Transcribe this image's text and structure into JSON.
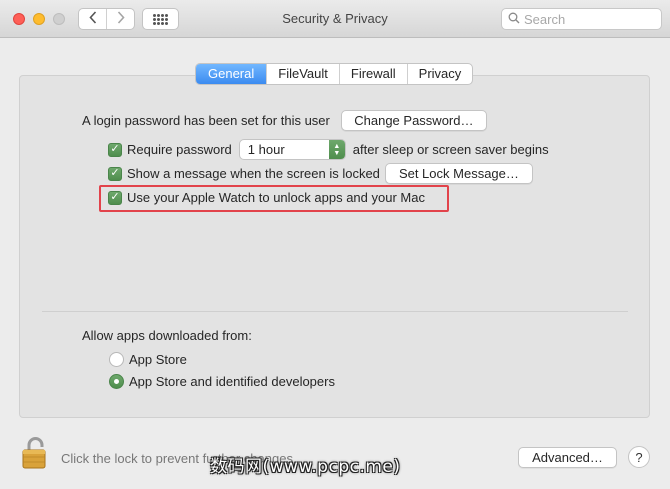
{
  "window": {
    "title": "Security & Privacy",
    "search_placeholder": "Search"
  },
  "toolbar": {
    "back_icon": "chevron-left-icon",
    "forward_icon": "chevron-right-icon",
    "show_all_icon": "grid-icon"
  },
  "tabs": [
    {
      "label": "General",
      "active": true
    },
    {
      "label": "FileVault",
      "active": false
    },
    {
      "label": "Firewall",
      "active": false
    },
    {
      "label": "Privacy",
      "active": false
    }
  ],
  "general": {
    "login_password_text": "A login password has been set for this user",
    "change_password_button": "Change Password…",
    "require_password": {
      "checked": true,
      "label": "Require password",
      "selected_value": "1 hour",
      "suffix": "after sleep or screen saver begins"
    },
    "show_message": {
      "checked": true,
      "label": "Show a message when the screen is locked",
      "button": "Set Lock Message…"
    },
    "apple_watch": {
      "checked": true,
      "label": "Use your Apple Watch to unlock apps and your Mac",
      "highlight_color": "#e2434b"
    },
    "allow_apps": {
      "label": "Allow apps downloaded from:",
      "options": [
        {
          "label": "App Store",
          "selected": false
        },
        {
          "label": "App Store and identified developers",
          "selected": true
        }
      ]
    }
  },
  "footer": {
    "lock_text": "Click the lock to prevent further changes.",
    "advanced_button": "Advanced…",
    "help_button": "?"
  },
  "watermark": "数码网(www.pcpc.me)",
  "colors": {
    "accent_tab": "#3b8bf0",
    "checkbox": "#4f8e4d",
    "close": "#fe5f57",
    "minimize": "#febc2e"
  }
}
